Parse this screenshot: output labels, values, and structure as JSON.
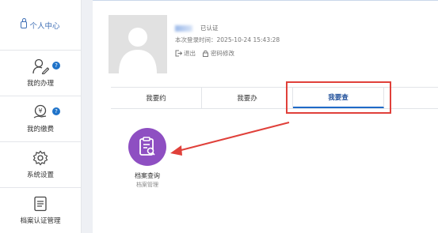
{
  "sidebar": {
    "header": "个人中心",
    "items": [
      {
        "label": "我的办理",
        "icon": "person-edit-icon",
        "badge": "?"
      },
      {
        "label": "我的缴费",
        "icon": "payment-icon",
        "badge": "?"
      },
      {
        "label": "系统设置",
        "icon": "gear-icon"
      },
      {
        "label": "档案认证管理",
        "icon": "document-list-icon"
      }
    ]
  },
  "profile": {
    "status": "已认证",
    "login_label": "本次登录时间：",
    "login_time": "2025-10-24 15:43:28",
    "logout": "退出",
    "change_password": "密码修改"
  },
  "tabs": [
    {
      "label": "我要约"
    },
    {
      "label": "我要办"
    },
    {
      "label": "我要查",
      "active": true
    }
  ],
  "service": {
    "title": "档案查询",
    "subtitle": "档案管理",
    "icon": "clipboard-search-icon",
    "color": "#8e4fc2"
  },
  "annotation_color": "#e0403a"
}
